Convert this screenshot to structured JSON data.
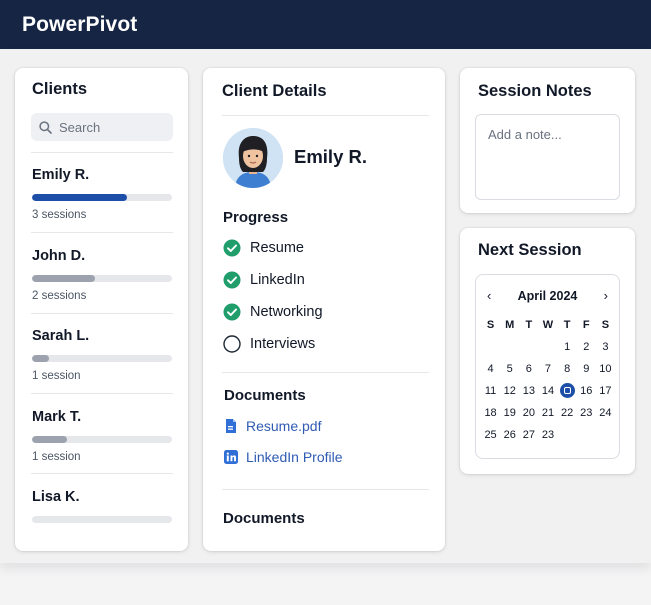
{
  "app": {
    "title": "PowerPivot"
  },
  "clients": {
    "title": "Clients",
    "search_placeholder": "Search",
    "items": [
      {
        "name": "Emily R.",
        "sessions": "3 sessions",
        "progress": 0.68,
        "color": "#1e4fa8"
      },
      {
        "name": "John D.",
        "sessions": "2 sessions",
        "progress": 0.45,
        "color": "#9ca3af"
      },
      {
        "name": "Sarah L.",
        "sessions": "1 session",
        "progress": 0.12,
        "color": "#9ca3af"
      },
      {
        "name": "Mark T.",
        "sessions": "1 session",
        "progress": 0.25,
        "color": "#9ca3af"
      },
      {
        "name": "Lisa K.",
        "sessions": "",
        "progress": 0.0,
        "color": "#9ca3af"
      }
    ]
  },
  "details": {
    "title": "Client Details",
    "client_name": "Emily R.",
    "progress_heading": "Progress",
    "progress_items": [
      {
        "label": "Resume",
        "done": true
      },
      {
        "label": "LinkedIn",
        "done": true
      },
      {
        "label": "Networking",
        "done": true
      },
      {
        "label": "Interviews",
        "done": false
      }
    ],
    "documents_heading": "Documents",
    "documents": [
      {
        "label": "Resume.pdf",
        "icon": "document-icon"
      },
      {
        "label": "LinkedIn Profile",
        "icon": "linkedin-icon"
      }
    ],
    "documents_heading_2": "Documents"
  },
  "notes": {
    "title": "Session Notes",
    "placeholder": "Add a note..."
  },
  "next_session": {
    "title": "Next Session",
    "month": "April 2024",
    "weekdays": [
      "S",
      "M",
      "T",
      "W",
      "T",
      "F",
      "S"
    ],
    "days": [
      "",
      "",
      "",
      "",
      "",
      "1",
      "2",
      "3",
      "4",
      "5",
      "6",
      "7",
      "8",
      "9",
      "10",
      "11",
      "12",
      "13",
      "14",
      "15",
      "16",
      "17",
      "18",
      "19",
      "20",
      "21",
      "22",
      "23",
      "24",
      "25",
      "26",
      "27",
      "23"
    ],
    "selected_day": "15"
  },
  "colors": {
    "header": "#172544",
    "accent": "#1e4fa8",
    "check": "#1f9e6b",
    "link": "#2f5bb3"
  }
}
